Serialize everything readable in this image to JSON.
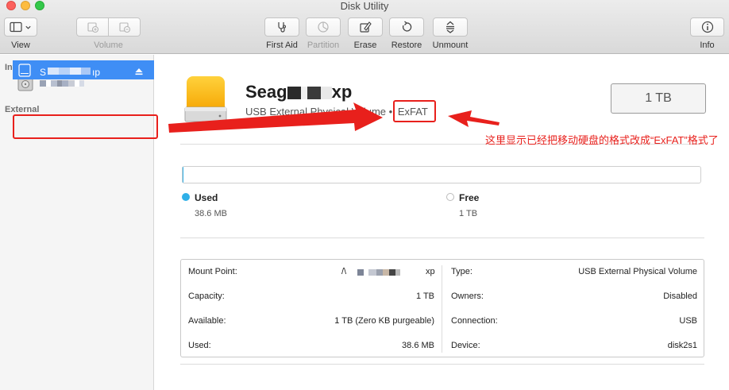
{
  "window": {
    "title": "Disk Utility"
  },
  "toolbar": {
    "view": "View",
    "volume": "Volume",
    "first_aid": "First Aid",
    "partition": "Partition",
    "erase": "Erase",
    "restore": "Restore",
    "unmount": "Unmount",
    "info": "Info"
  },
  "sidebar": {
    "internal_header": "Internal",
    "external_header": "External",
    "selected_prefix": "S",
    "selected_suffix": "ıp"
  },
  "drive": {
    "name_prefix": "Seag",
    "name_suffix": "xp",
    "subtitle": "USB External Physical Volume •",
    "format": "ExFAT",
    "size": "1 TB"
  },
  "usage": {
    "used_label": "Used",
    "used_value": "38.6 MB",
    "free_label": "Free",
    "free_value": "1 TB",
    "used_fraction": 0.001,
    "used_color": "#2fb0e8",
    "free_color": "#ffffff"
  },
  "info": {
    "mount_point_label": "Mount Point:",
    "mount_point_prefix": "/\\",
    "mount_point_suffix": "xp",
    "capacity_label": "Capacity:",
    "capacity_value": "1 TB",
    "available_label": "Available:",
    "available_value": "1 TB (Zero KB purgeable)",
    "used_label": "Used:",
    "used_value": "38.6 MB",
    "type_label": "Type:",
    "type_value": "USB External Physical Volume",
    "owners_label": "Owners:",
    "owners_value": "Disabled",
    "connection_label": "Connection:",
    "connection_value": "USB",
    "device_label": "Device:",
    "device_value": "disk2s1"
  },
  "annotation": {
    "text": "这里显示已经把移动硬盘的格式改成“ExFAT”格式了",
    "color": "#e8201c"
  },
  "colors": {
    "accent": "#3f8ef5",
    "highlight": "#e8201c"
  }
}
